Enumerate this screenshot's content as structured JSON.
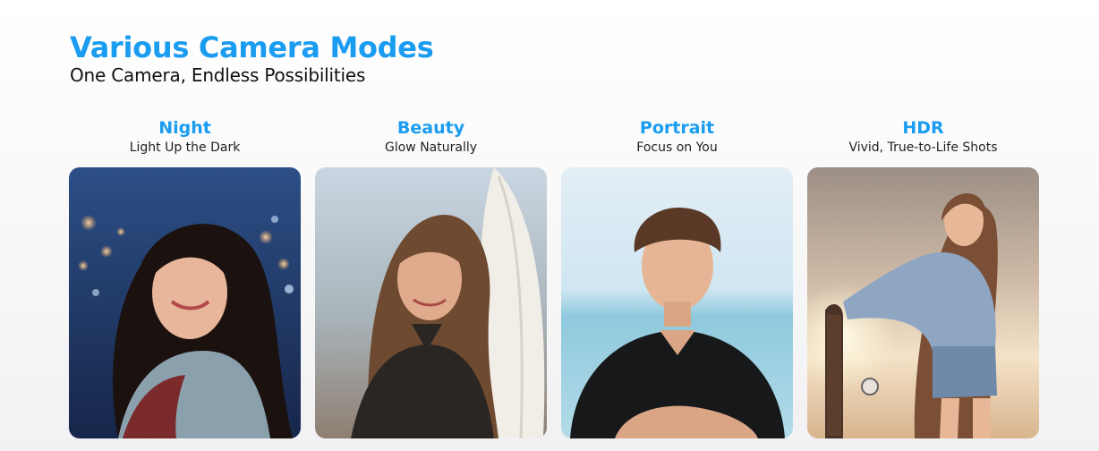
{
  "header": {
    "title": "Various Camera Modes",
    "subtitle": "One Camera, Endless Possibilities"
  },
  "modes": [
    {
      "name": "Night",
      "description": "Light Up the Dark",
      "photo_icon": "woman-night-portrait-icon"
    },
    {
      "name": "Beauty",
      "description": "Glow Naturally",
      "photo_icon": "woman-surfboard-portrait-icon"
    },
    {
      "name": "Portrait",
      "description": "Focus on You",
      "photo_icon": "man-beach-portrait-icon"
    },
    {
      "name": "HDR",
      "description": "Vivid, True-to-Life Shots",
      "photo_icon": "woman-skateboard-sunset-icon"
    }
  ],
  "colors": {
    "accent": "#1a9cf0",
    "text": "#111111"
  }
}
